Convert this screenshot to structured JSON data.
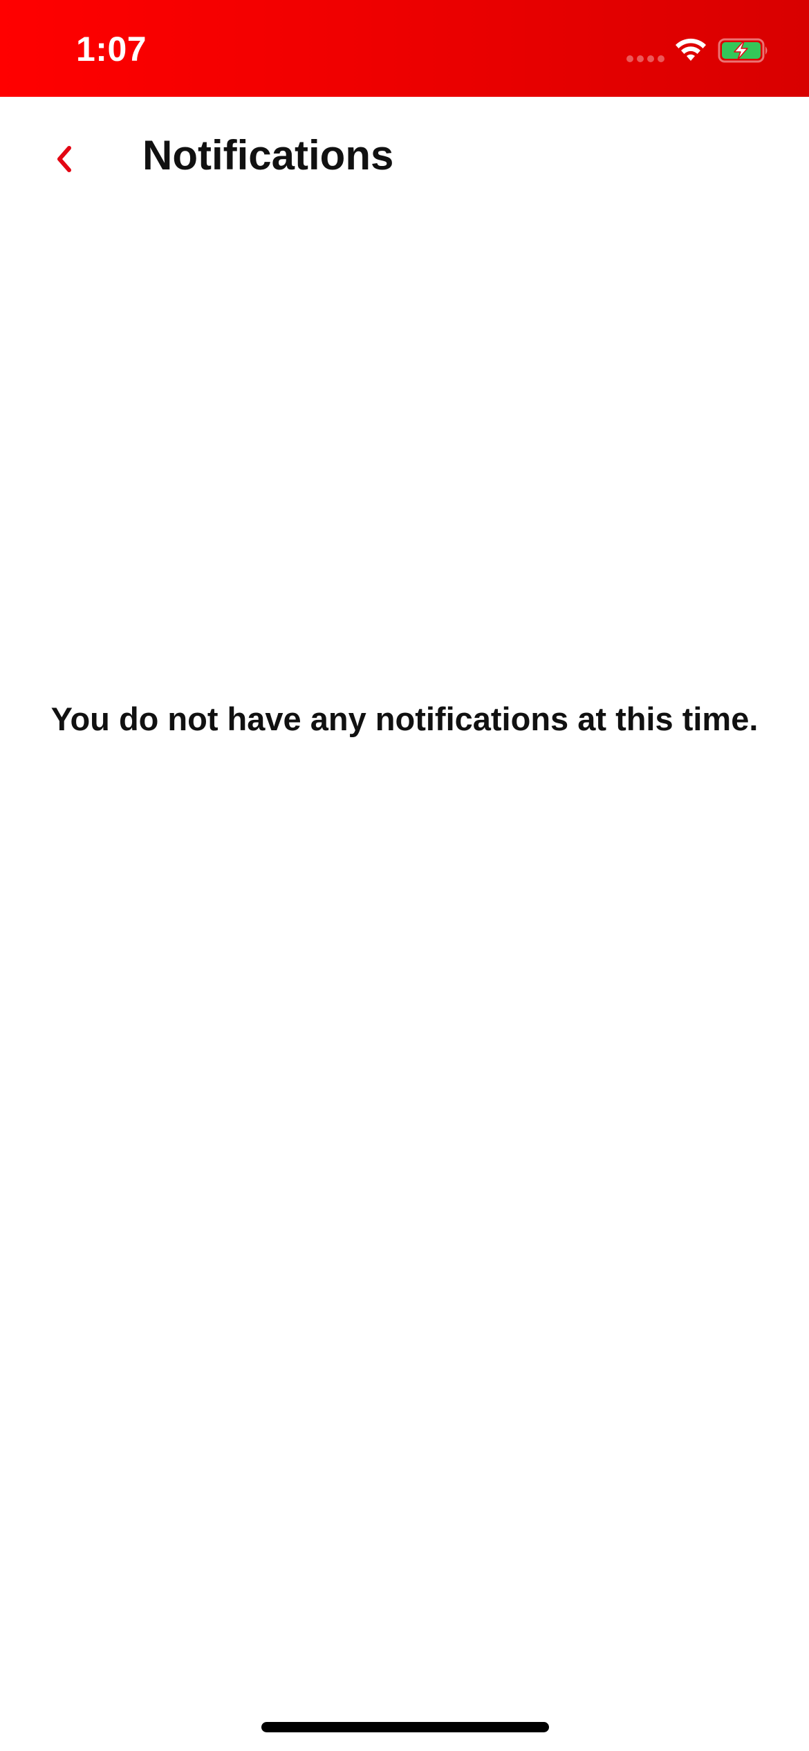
{
  "status_bar": {
    "time": "1:07",
    "background_color": "#e60000",
    "icons": [
      "cellular-signal-icon",
      "wifi-icon",
      "battery-charging-icon"
    ],
    "battery_fill_color": "#34c759"
  },
  "header": {
    "back_icon": "chevron-left-icon",
    "back_icon_color": "#e30613",
    "title": "Notifications"
  },
  "main": {
    "empty_message": "You do not have any notifications at this time."
  }
}
